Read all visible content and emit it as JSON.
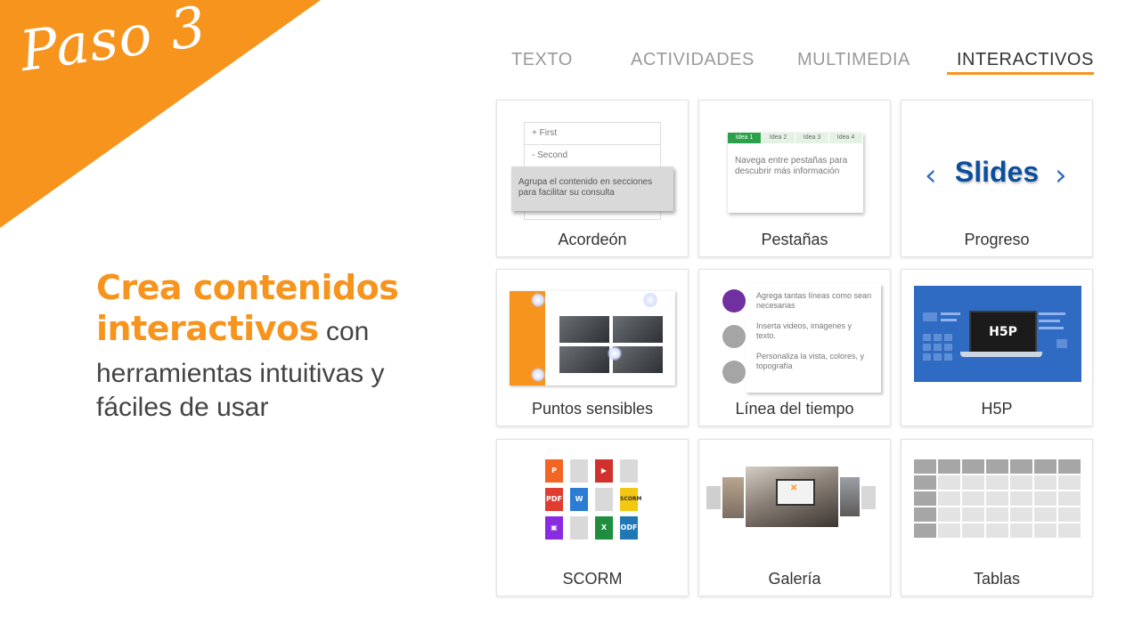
{
  "banner": {
    "text": "Paso 3",
    "color": "#f7941d"
  },
  "headline": {
    "line1": "Crea contenidos",
    "line2_bold": "interactivos",
    "line2_rest": " con",
    "line3": "herramientas intuitivas y",
    "line4": "fáciles de usar"
  },
  "tabs": [
    {
      "label": "TEXTO",
      "active": false
    },
    {
      "label": "ACTIVIDADES",
      "active": false
    },
    {
      "label": "MULTIMEDIA",
      "active": false
    },
    {
      "label": "INTERACTIVOS",
      "active": true
    }
  ],
  "accent_color": "#f7941d",
  "cards": [
    {
      "label": "Acordeón"
    },
    {
      "label": "Pestañas"
    },
    {
      "label": "Progreso"
    },
    {
      "label": "Puntos sensibles"
    },
    {
      "label": "Línea del tiempo"
    },
    {
      "label": "H5P"
    },
    {
      "label": "SCORM"
    },
    {
      "label": "Galería"
    },
    {
      "label": "Tablas"
    }
  ],
  "acordeon": {
    "row1": "+ First",
    "row2": "- Second",
    "popup": "Agrupa el contenido en secciones para facilitar su consulta"
  },
  "pestanas": {
    "tabs": [
      "Idea 1",
      "Idea 2",
      "Idea 3",
      "Idea 4"
    ],
    "text": "Navega entre pestañas para descubrir más información"
  },
  "progreso": {
    "word": "Slides",
    "prev": "‹",
    "next": "›"
  },
  "linea": {
    "items": [
      "Agrega tantas líneas como sean necesarias",
      "Inserta videos, imágenes y texto.",
      "Personaliza la vista, colores, y topografía"
    ]
  },
  "h5p": {
    "logo": "H5P"
  },
  "scorm": {
    "icons": [
      {
        "label": "P",
        "color": "#f26522"
      },
      {
        "label": "",
        "color": "#d9d9d9"
      },
      {
        "label": "▶",
        "color": "#d0312d"
      },
      {
        "label": "",
        "color": "#d9d9d9"
      },
      {
        "label": "PDF",
        "color": "#e03c31"
      },
      {
        "label": "W",
        "color": "#2b7cd3"
      },
      {
        "label": "",
        "color": "#d9d9d9"
      },
      {
        "label": "SCORM",
        "color": "#f2c811"
      },
      {
        "label": "▣",
        "color": "#8a2be2"
      },
      {
        "label": "",
        "color": "#d9d9d9"
      },
      {
        "label": "X",
        "color": "#1e8e3e"
      },
      {
        "label": "ODF",
        "color": "#1f78b4"
      }
    ]
  }
}
